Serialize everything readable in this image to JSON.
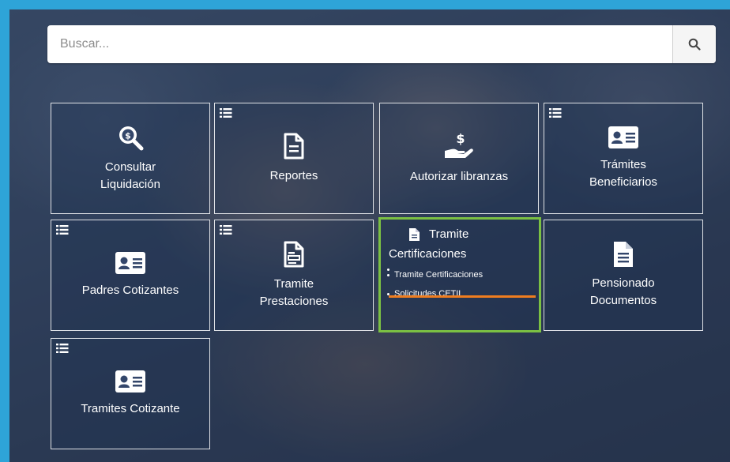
{
  "search": {
    "placeholder": "Buscar..."
  },
  "tiles": [
    {
      "label_line1": "Consultar",
      "label_line2": "Liquidación"
    },
    {
      "label_line1": "Reportes"
    },
    {
      "label_line1": "Autorizar libranzas"
    },
    {
      "label_line1": "Trámites",
      "label_line2": "Beneficiarios"
    },
    {
      "label_line1": "Padres Cotizantes"
    },
    {
      "label_line1": "Tramite",
      "label_line2": "Prestaciones"
    },
    {
      "label_line1": "Tramite",
      "label_line2": "Certificaciones",
      "submenu": [
        "Tramite Certificaciones",
        "Solicitudes CETIL"
      ]
    },
    {
      "label_line1": "Pensionado",
      "label_line2": "Documentos"
    },
    {
      "label_line1": "Tramites Cotizante"
    }
  ],
  "colors": {
    "frame": "#2ea4d8",
    "selected_border": "#7bc043",
    "active_underline": "#ef7d1f"
  }
}
